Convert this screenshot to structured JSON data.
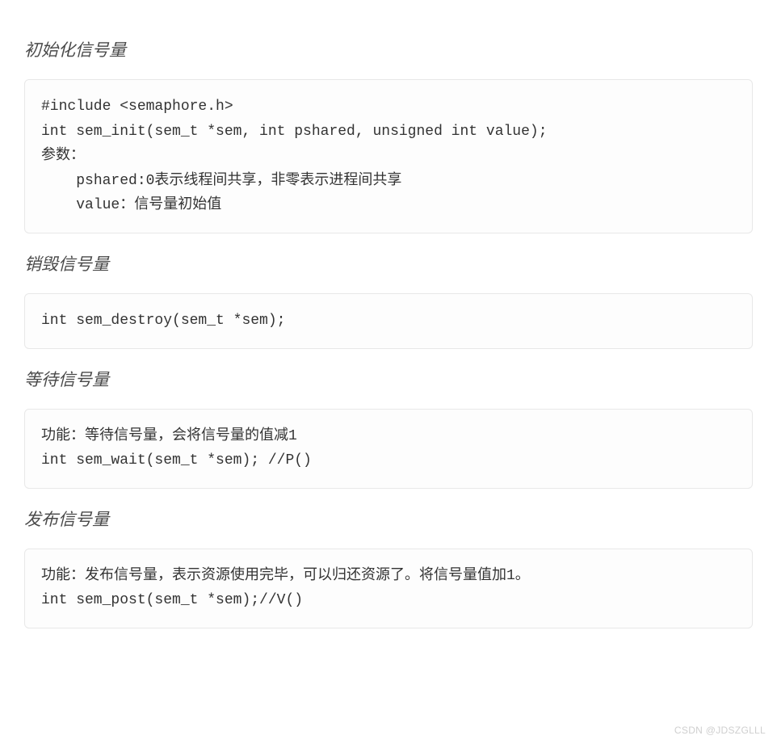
{
  "sections": [
    {
      "heading": "初始化信号量",
      "code": "#include <semaphore.h>\nint sem_init(sem_t *sem, int pshared, unsigned int value);\n参数：\n    pshared:0表示线程间共享，非零表示进程间共享\n    value：信号量初始值"
    },
    {
      "heading": "销毁信号量",
      "code": "int sem_destroy(sem_t *sem);"
    },
    {
      "heading": "等待信号量",
      "code": "功能：等待信号量，会将信号量的值减1\nint sem_wait(sem_t *sem); //P()"
    },
    {
      "heading": "发布信号量",
      "code": "功能：发布信号量，表示资源使用完毕，可以归还资源了。将信号量值加1。\nint sem_post(sem_t *sem);//V()"
    }
  ],
  "watermark": "CSDN @JDSZGLLL"
}
